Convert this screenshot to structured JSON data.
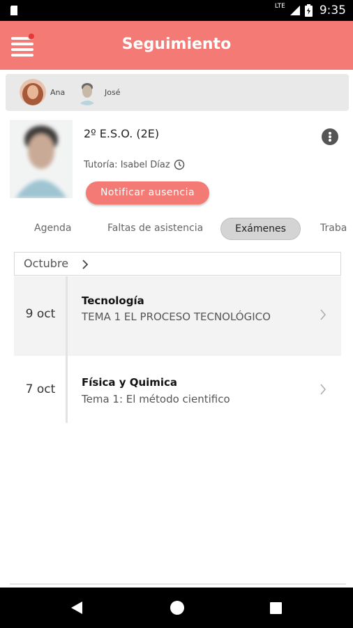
{
  "status_bar": {
    "network": "LTE",
    "time": "9:35",
    "icons": [
      "sd-card-icon",
      "signal-icon",
      "battery-icon"
    ]
  },
  "header": {
    "title": "Seguimiento",
    "menu_icon": "menu-icon",
    "notification_dot_color": "#e53935",
    "color": "#f47b75"
  },
  "children": [
    {
      "name": "Ana"
    },
    {
      "name": "José"
    }
  ],
  "student": {
    "group": "2º E.S.O. (2E)",
    "tutor": "Tutoría: Isabel Díaz",
    "notify_label": "Notificar ausencia"
  },
  "tabs": [
    {
      "label": "Agenda",
      "active": false
    },
    {
      "label": "Faltas de asistencia",
      "active": false
    },
    {
      "label": "Exámenes",
      "active": true
    },
    {
      "label": "Traba",
      "active": false
    }
  ],
  "month": {
    "label": "Octubre"
  },
  "exams": [
    {
      "date": "9 oct",
      "subject": "Tecnología",
      "topic": "TEMA 1 EL PROCESO TECNOLÓGICO"
    },
    {
      "date": "7 oct",
      "subject": "Física y Quimica",
      "topic": "Tema 1: El método cientifico"
    }
  ]
}
